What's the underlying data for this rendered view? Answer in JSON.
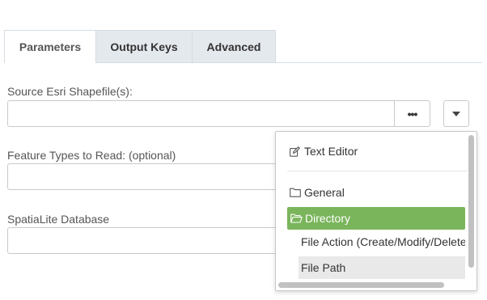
{
  "tabs": [
    {
      "label": "Parameters",
      "active": true
    },
    {
      "label": "Output Keys",
      "active": false
    },
    {
      "label": "Advanced",
      "active": false
    }
  ],
  "fields": {
    "source_label": "Source Esri Shapefile(s):",
    "source_value": "",
    "browse_label": "•••",
    "feature_types_label": "Feature Types to Read: (optional)",
    "feature_types_value": "",
    "spatialite_label": "SpatiaLite Database",
    "spatialite_value": ""
  },
  "menu": {
    "items": [
      {
        "label": "Text Editor",
        "icon": "edit-icon"
      },
      {
        "label": "General",
        "icon": "folder-icon"
      },
      {
        "label": "Directory",
        "icon": "folder-open-icon",
        "selected": true
      },
      {
        "label": "File Action (Create/Modify/Delete",
        "icon": null
      },
      {
        "label": "File Path",
        "icon": null,
        "hover": true
      }
    ]
  },
  "colors": {
    "selected": "#7ab55c",
    "tab_inactive": "#e4e9ee",
    "hover": "#e9e9e9"
  }
}
